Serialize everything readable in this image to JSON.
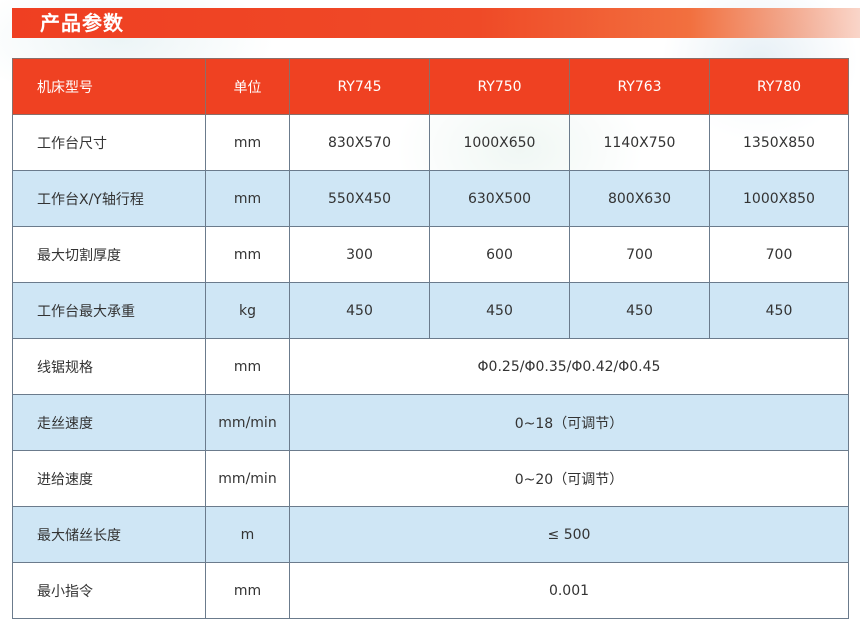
{
  "title": "产品参数",
  "table": {
    "headers": [
      "机床型号",
      "单位",
      "RY745",
      "RY750",
      "RY763",
      "RY780"
    ],
    "rows": [
      {
        "label": "工作台尺寸",
        "unit": "mm",
        "values": [
          "830X570",
          "1000X650",
          "1140X750",
          "1350X850"
        ]
      },
      {
        "label": "工作台X/Y轴行程",
        "unit": "mm",
        "values": [
          "550X450",
          "630X500",
          "800X630",
          "1000X850"
        ]
      },
      {
        "label": "最大切割厚度",
        "unit": "mm",
        "values": [
          "300",
          "600",
          "700",
          "700"
        ]
      },
      {
        "label": "工作台最大承重",
        "unit": "kg",
        "values": [
          "450",
          "450",
          "450",
          "450"
        ]
      },
      {
        "label": "线锯规格",
        "unit": "mm",
        "merged": "Φ0.25/Φ0.35/Φ0.42/Φ0.45"
      },
      {
        "label": "走丝速度",
        "unit": "mm/min",
        "merged": "0~18（可调节）"
      },
      {
        "label": "进给速度",
        "unit": "mm/min",
        "merged": "0~20（可调节）"
      },
      {
        "label": "最大储丝长度",
        "unit": "m",
        "merged": "≤ 500"
      },
      {
        "label": "最小指令",
        "unit": "mm",
        "merged": "0.001"
      }
    ]
  },
  "colors": {
    "header_red": "#ef4122",
    "row_blue": "#cfe6f5"
  }
}
